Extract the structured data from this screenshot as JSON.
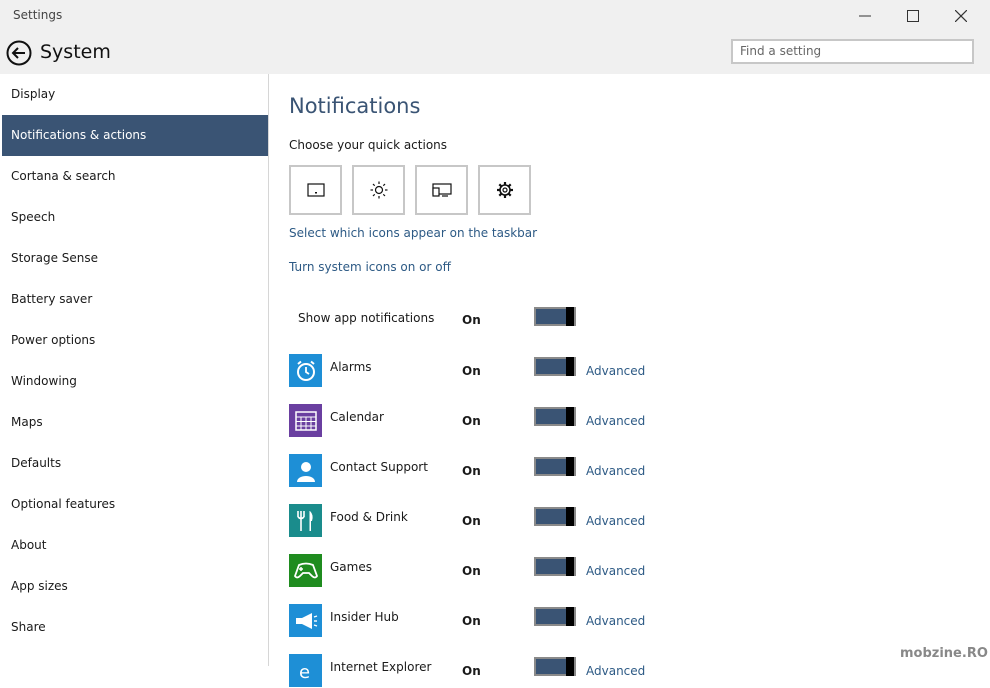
{
  "window": {
    "title": "Settings"
  },
  "header": {
    "page_title": "System",
    "search_placeholder": "Find a setting"
  },
  "sidebar": {
    "items": [
      {
        "label": "Display"
      },
      {
        "label": "Notifications & actions",
        "active": true
      },
      {
        "label": "Cortana & search"
      },
      {
        "label": "Speech"
      },
      {
        "label": "Storage Sense"
      },
      {
        "label": "Battery saver"
      },
      {
        "label": "Power options"
      },
      {
        "label": "Windowing"
      },
      {
        "label": "Maps"
      },
      {
        "label": "Defaults"
      },
      {
        "label": "Optional features"
      },
      {
        "label": "About"
      },
      {
        "label": "App sizes"
      },
      {
        "label": "Share"
      }
    ]
  },
  "main": {
    "heading": "Notifications",
    "quick_actions_label": "Choose your quick actions",
    "quick_actions": [
      {
        "icon": "tablet-mode-icon"
      },
      {
        "icon": "brightness-icon"
      },
      {
        "icon": "connect-icon"
      },
      {
        "icon": "settings-gear-icon"
      }
    ],
    "link_taskbar_icons": "Select which icons appear on the taskbar",
    "link_system_icons": "Turn system icons on or off",
    "show_app_notifications": {
      "label": "Show app notifications",
      "state": "On"
    },
    "advanced_label": "Advanced",
    "apps": [
      {
        "name": "Alarms",
        "state": "On",
        "icon": "alarm-clock-icon",
        "color": "#1e8fd6"
      },
      {
        "name": "Calendar",
        "state": "On",
        "icon": "calendar-icon",
        "color": "#6a3fa0"
      },
      {
        "name": "Contact Support",
        "state": "On",
        "icon": "person-icon",
        "color": "#1e8fd6"
      },
      {
        "name": "Food & Drink",
        "state": "On",
        "icon": "fork-knife-icon",
        "color": "#1a8c8c"
      },
      {
        "name": "Games",
        "state": "On",
        "icon": "gamepad-icon",
        "color": "#1f8c1f"
      },
      {
        "name": "Insider Hub",
        "state": "On",
        "icon": "megaphone-icon",
        "color": "#1e8fd6"
      },
      {
        "name": "Internet Explorer",
        "state": "On",
        "icon": "ie-icon",
        "color": "#1e8fd6"
      }
    ]
  },
  "watermark": "mobzine.RO",
  "colors": {
    "accent": "#3a5474",
    "link": "#2d5a85"
  }
}
